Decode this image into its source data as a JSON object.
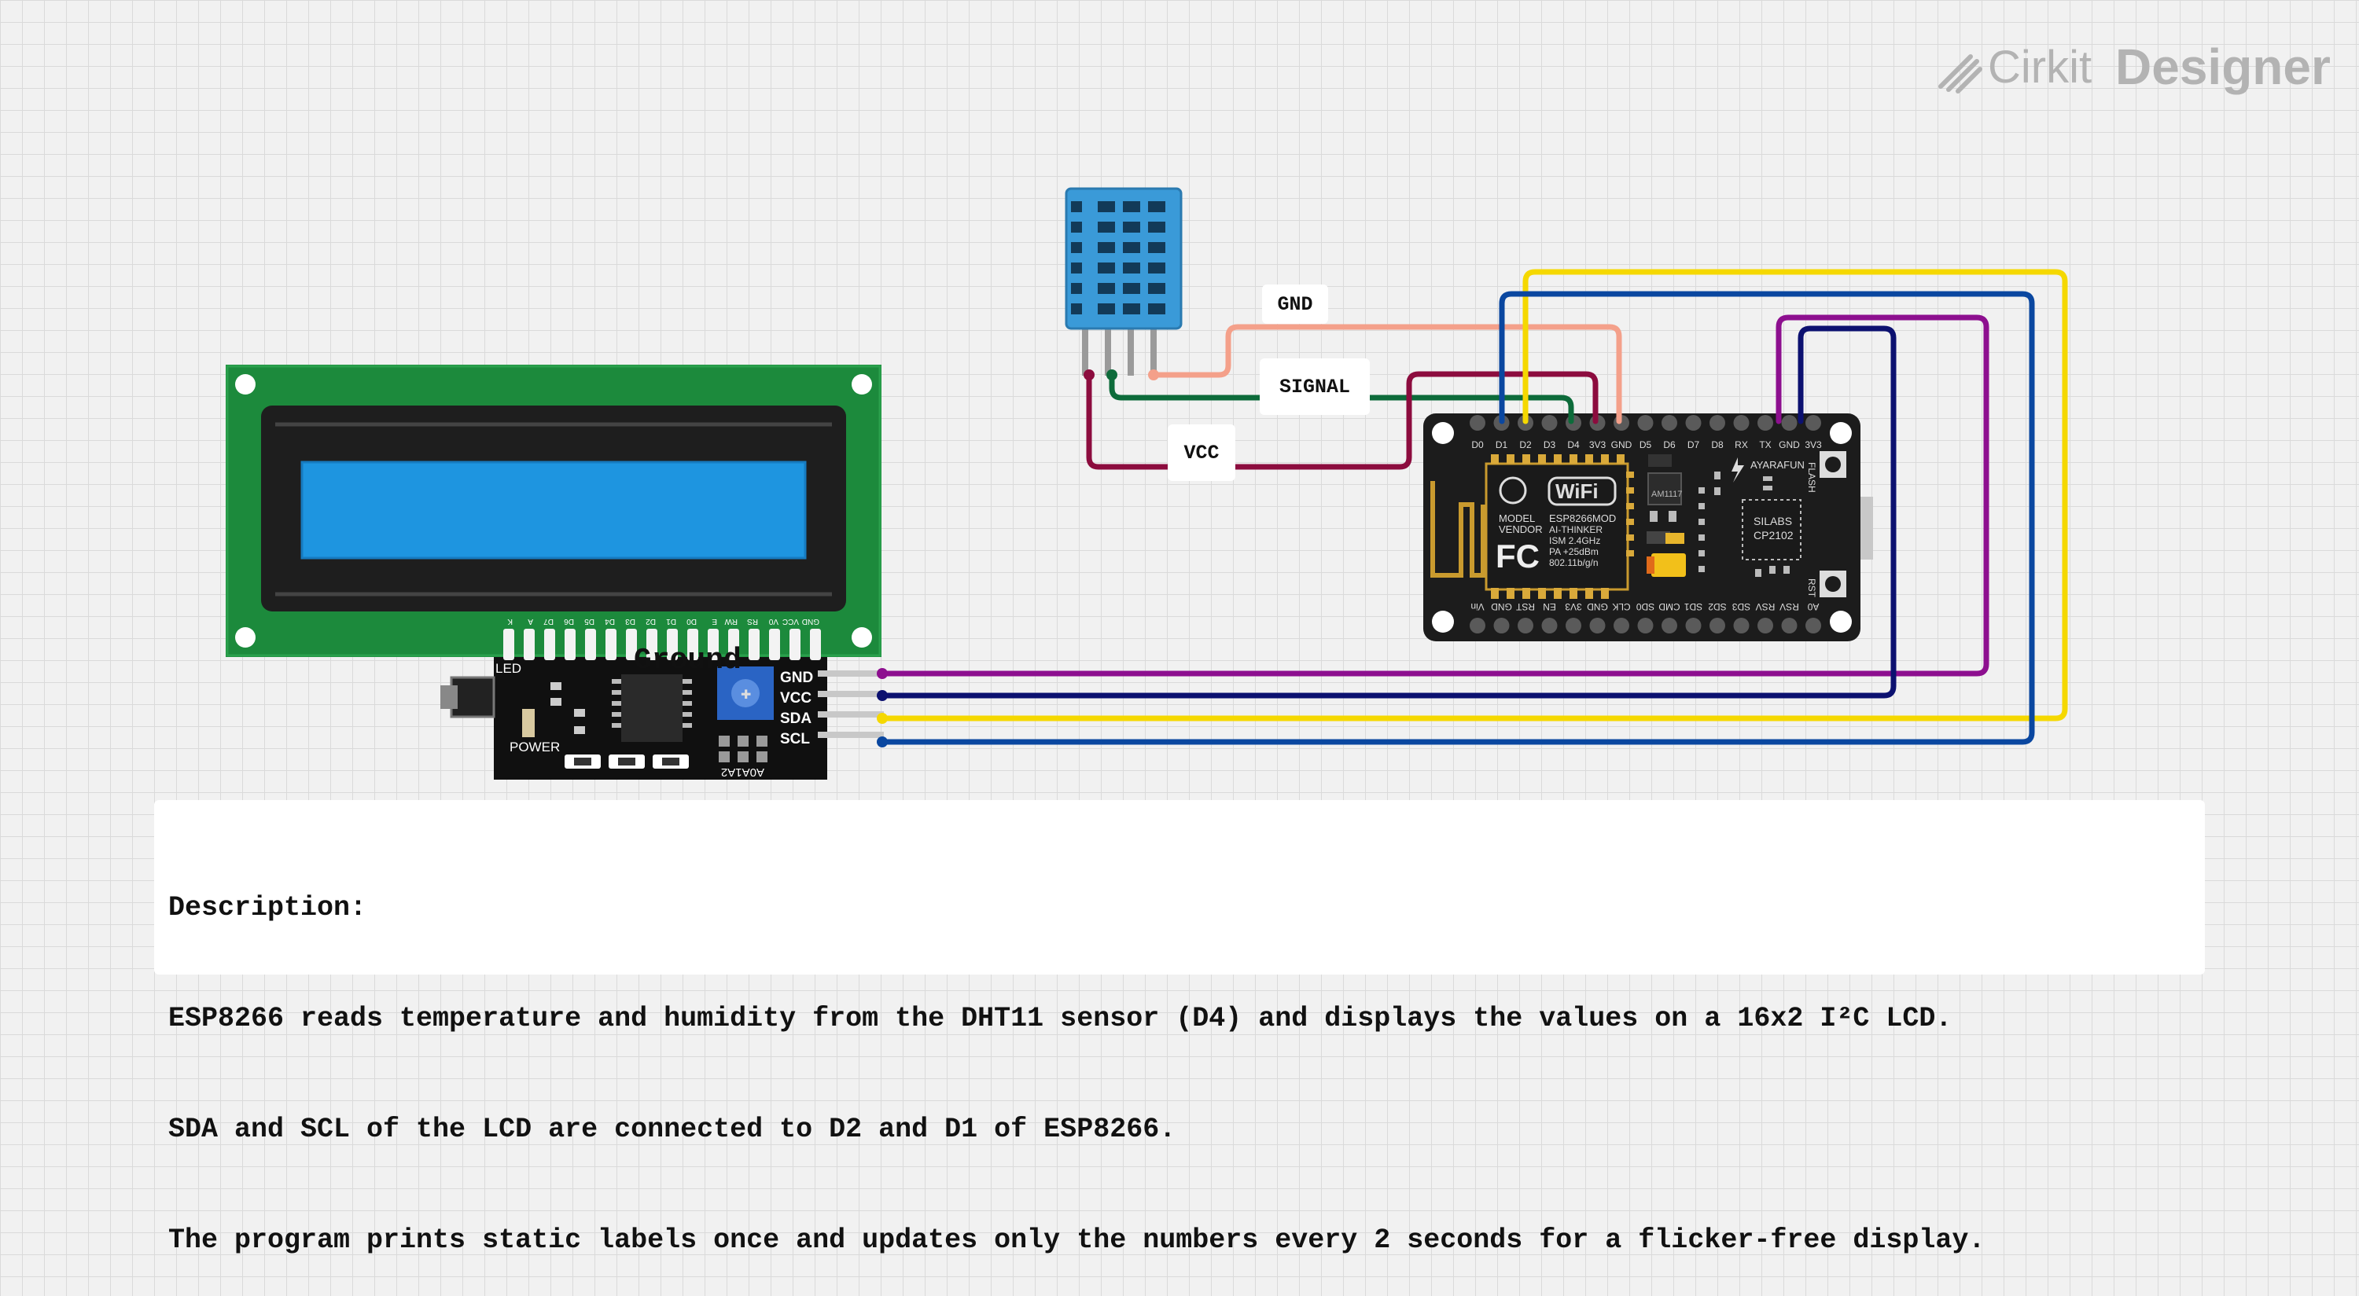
{
  "brand": {
    "name_light": "Cirkit",
    "name_bold": "Designer",
    "icon": "cirkit-logo-icon"
  },
  "wire_labels": {
    "gnd": "GND",
    "signal": "SIGNAL",
    "vcc": "VCC",
    "ground": "Ground"
  },
  "lcd": {
    "top_pins": [
      "GND",
      "VCC",
      "V0",
      "RS",
      "RW",
      "E",
      "D0",
      "D1",
      "D2",
      "D3",
      "D4",
      "D5",
      "D6",
      "D7",
      "A",
      "K"
    ],
    "i2c_pins": [
      "GND",
      "VCC",
      "SDA",
      "SCL"
    ],
    "led_label": "LED",
    "power_label": "POWER",
    "addr_label": "A0A1A2"
  },
  "esp": {
    "top_pins": [
      "D0",
      "D1",
      "D2",
      "D3",
      "D4",
      "3V3",
      "GND",
      "D5",
      "D6",
      "D7",
      "D8",
      "RX",
      "TX",
      "GND",
      "3V3"
    ],
    "bottom_pins": [
      "A0",
      "RSV",
      "RSV",
      "SD3",
      "SD2",
      "SD1",
      "CMD",
      "SD0",
      "CLK",
      "GND",
      "3V3",
      "EN",
      "RST",
      "GND",
      "Vin"
    ],
    "module_text": [
      "MODEL",
      "VENDOR",
      "ESP8266MOD",
      "AI-THINKER",
      "ISM 2.4GHz",
      "PA +25dBm",
      "802.11b/g/n"
    ],
    "wifi_label": "WiFi",
    "fcc_label": "FC",
    "usb_chip": [
      "SILABS",
      "CP2102"
    ],
    "brand_label": "AYARAFUN",
    "regulator": "AM1117",
    "flash_label": "FLASH",
    "rst_label": "RST"
  },
  "colors": {
    "wire_gnd_dht": "#f4a08a",
    "wire_signal": "#0d6b3a",
    "wire_vcc_dht": "#8c0c3e",
    "wire_lcd_gnd": "#8d0f8f",
    "wire_lcd_vcc": "#0c1170",
    "wire_sda": "#f5d800",
    "wire_scl": "#0a47a0"
  },
  "description": {
    "heading": "Description:",
    "line1": "ESP8266 reads temperature and humidity from the DHT11 sensor (D4) and displays the values on a 16x2 I²C LCD.",
    "line2": "SDA and SCL of the LCD are connected to D2 and D1 of ESP8266.",
    "line3": "The program prints static labels once and updates only the numbers every 2 seconds for a flicker-free display."
  }
}
